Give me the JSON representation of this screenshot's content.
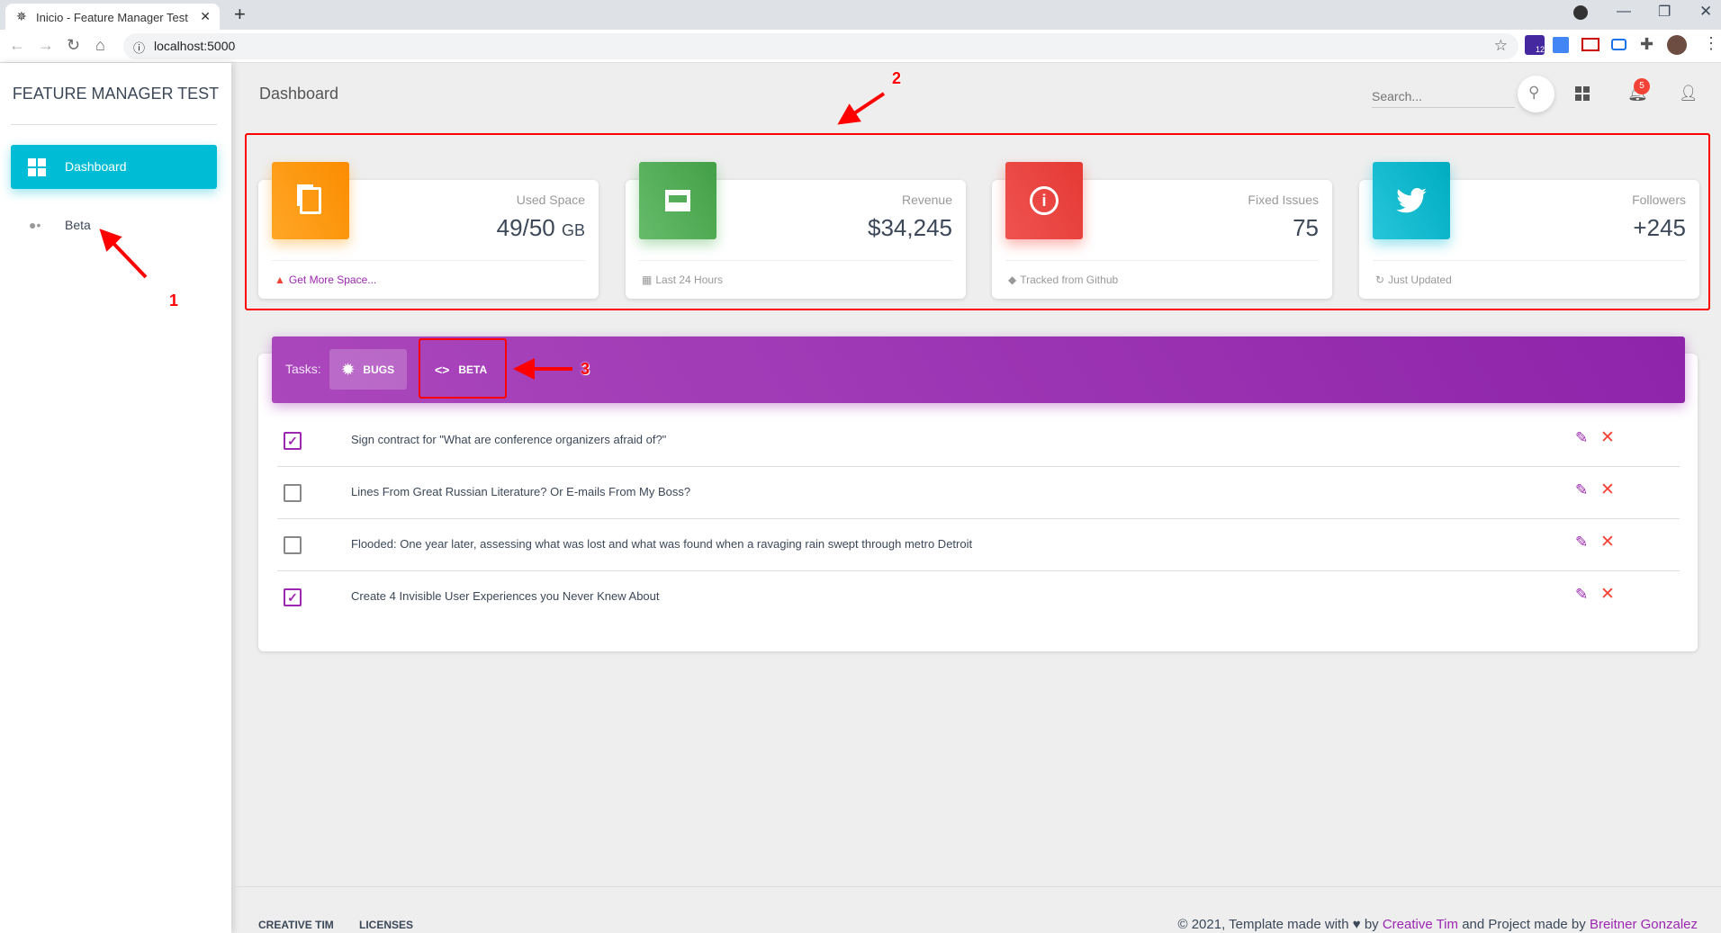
{
  "browser": {
    "tab_title": "Inicio - Feature Manager Test",
    "url": "localhost:5000",
    "extension_badge": "12"
  },
  "sidebar": {
    "brand": "FEATURE MANAGER TEST",
    "items": [
      {
        "label": "Dashboard",
        "active": true
      },
      {
        "label": "Beta",
        "active": false
      }
    ]
  },
  "header": {
    "title": "Dashboard",
    "search_placeholder": "Search...",
    "notifications": "5"
  },
  "stats": [
    {
      "label": "Used Space",
      "value": "49/50",
      "unit": "GB",
      "footer": "Get More Space...",
      "color": "#ff9800",
      "icon": "content-copy-icon",
      "footer_icon": "warning-icon"
    },
    {
      "label": "Revenue",
      "value": "$34,245",
      "unit": "",
      "footer": "Last 24 Hours",
      "color": "#4caf50",
      "icon": "store-icon",
      "footer_icon": "calendar-icon"
    },
    {
      "label": "Fixed Issues",
      "value": "75",
      "unit": "",
      "footer": "Tracked from Github",
      "color": "#f44336",
      "icon": "info-icon",
      "footer_icon": "tag-icon"
    },
    {
      "label": "Followers",
      "value": "+245",
      "unit": "",
      "footer": "Just Updated",
      "color": "#00bcd4",
      "icon": "twitter-icon",
      "footer_icon": "update-icon"
    }
  ],
  "tasks": {
    "label": "Tasks:",
    "tabs": [
      {
        "label": "BUGS",
        "icon": "bug-icon",
        "active": true
      },
      {
        "label": "BETA",
        "icon": "code-icon",
        "active": false
      }
    ],
    "rows": [
      {
        "text": "Sign contract for \"What are conference organizers afraid of?\"",
        "checked": true
      },
      {
        "text": "Lines From Great Russian Literature? Or E-mails From My Boss?",
        "checked": false
      },
      {
        "text": "Flooded: One year later, assessing what was lost and what was found when a ravaging rain swept through metro Detroit",
        "checked": false
      },
      {
        "text": "Create 4 Invisible User Experiences you Never Knew About",
        "checked": true
      }
    ]
  },
  "footer": {
    "links": [
      "CREATIVE TIM",
      "LICENSES"
    ],
    "copy_pre": "© 2021, Template made with",
    "copy_by": "by",
    "author1": "Creative Tim",
    "copy_mid": "and Project made by",
    "author2": "Breitner Gonzalez"
  },
  "annotations": [
    "1",
    "2",
    "3"
  ]
}
